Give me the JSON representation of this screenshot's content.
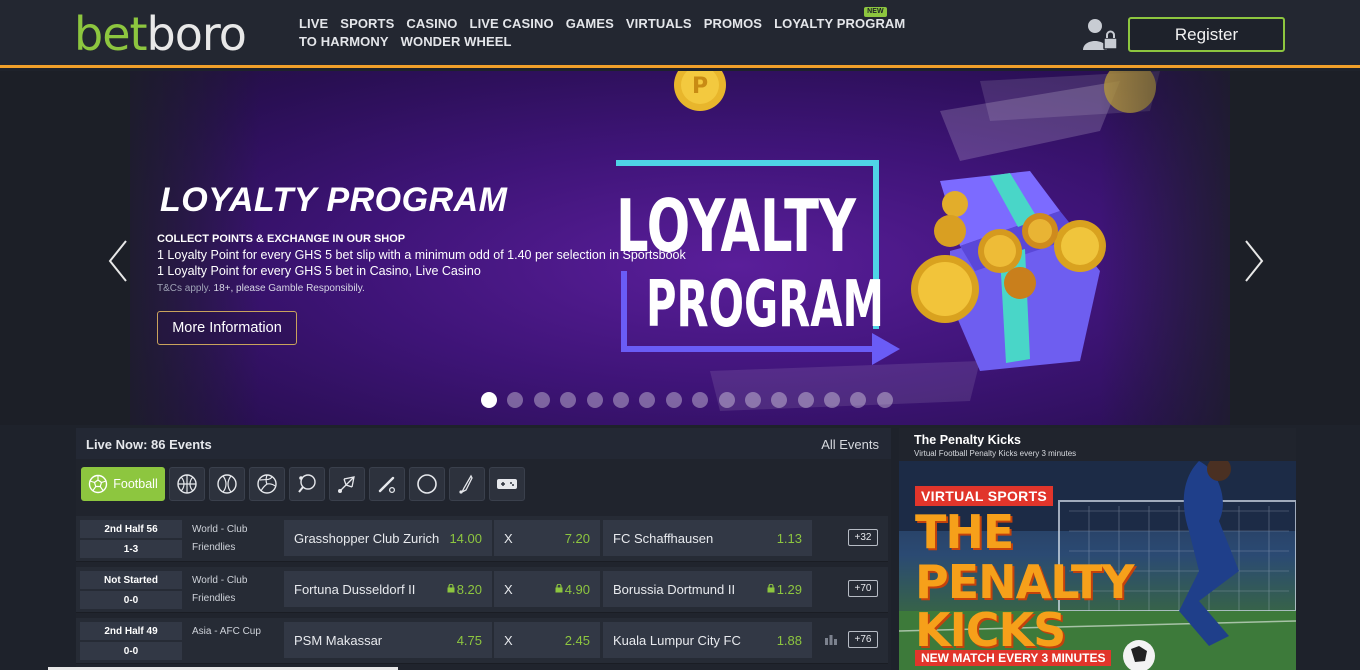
{
  "brand": {
    "part1": "bet",
    "part2": "boro"
  },
  "nav": {
    "items": [
      "LIVE",
      "SPORTS",
      "CASINO",
      "LIVE CASINO",
      "GAMES",
      "VIRTUALS",
      "PROMOS",
      "LOYALTY PROGRAM",
      "TO HARMONY",
      "WONDER WHEEL"
    ],
    "new_badge": "NEW"
  },
  "header": {
    "register_label": "Register"
  },
  "banner": {
    "title": "LOYALTY PROGRAM",
    "subtitle": "COLLECT POINTS & EXCHANGE IN OUR SHOP",
    "line1": "1 Loyalty Point for every GHS 5 bet slip with a minimum odd of 1.40 per selection in Sportsbook",
    "line2": "1 Loyalty Point for every GHS 5 bet in Casino, Live Casino",
    "terms_link": "T&Cs apply.",
    "terms_text": "18+, please Gamble Responsibily.",
    "button_label": "More Information",
    "art_line1": "LOYALTY",
    "art_line2": "PROGRAM",
    "slide_count": 16,
    "active_slide": 1
  },
  "live": {
    "title": "Live Now: 86 Events",
    "all_events": "All Events",
    "active_sport": "Football",
    "sport_icons": [
      "basketball-icon",
      "tennis-icon",
      "volleyball-icon",
      "table-tennis-icon",
      "badminton-icon",
      "baseball-icon",
      "ice-hockey-icon",
      "cricket-icon",
      "esports-icon"
    ],
    "matches": [
      {
        "status": "2nd Half 56",
        "score": "1-3",
        "league1": "World - Club",
        "league2": "Friendlies",
        "home": "Grasshopper Club Zurich",
        "home_odd": "14.00",
        "draw": "X",
        "draw_odd": "7.20",
        "away": "FC Schaffhausen",
        "away_odd": "1.13",
        "more": "+32"
      },
      {
        "status": "Not Started",
        "score": "0-0",
        "league1": "World - Club",
        "league2": "Friendlies",
        "home": "Fortuna Dusseldorf II",
        "home_odd": "8.20",
        "draw": "X",
        "draw_odd": "4.90",
        "away": "Borussia Dortmund II",
        "away_odd": "1.29",
        "more": "+70"
      },
      {
        "status": "2nd Half 49",
        "score": "0-0",
        "league1": "Asia - AFC Cup",
        "league2": "",
        "home": "PSM Makassar",
        "home_odd": "4.75",
        "draw": "X",
        "draw_odd": "2.45",
        "away": "Kuala Lumpur City FC",
        "away_odd": "1.88",
        "more": "+76"
      }
    ]
  },
  "penalty": {
    "title": "The Penalty Kicks",
    "subtitle": "Virtual Football Penalty Kicks every 3 minutes",
    "tag": "VIRTUAL SPORTS",
    "big1": "THE",
    "big2": "PENALTY",
    "big3": "KICKS",
    "footer": "NEW MATCH EVERY 3 MINUTES"
  },
  "colors": {
    "accent": "#8dc63f",
    "header_border": "#f1a02a",
    "banner_purple": "#3e1477"
  }
}
